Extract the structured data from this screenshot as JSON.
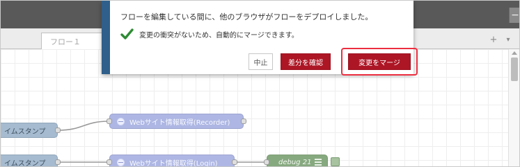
{
  "header": {
    "collapse_label": "−"
  },
  "tabs": [
    {
      "label": "フロー１"
    }
  ],
  "tabbar": {
    "add_label": "+",
    "menu_label": "▾"
  },
  "nodes": {
    "inject_1_label": "イムスタンプ",
    "inject_2_label": "イムスタンプ",
    "http_1_label": "Webサイト情報取得(Recorder)",
    "http_2_label": "Webサイト情報取得(Login)",
    "debug_label": "debug 21"
  },
  "dialog": {
    "message": "フローを編集している間に、他のブラウザがフローをデプロイしました。",
    "detail": "変更の衝突がないため、自動的にマージできます。",
    "cancel_label": "中止",
    "diff_label": "差分を確認",
    "merge_label": "変更をマージ"
  },
  "colors": {
    "dialog_accent": "#2f5f8a",
    "primary_button": "#ad1625",
    "highlight_outline": "#ec2e3f",
    "success_check": "#2e8b34",
    "inject_node": "#a6bbcf",
    "http_node": "#aeb7e3",
    "debug_node": "#87a980"
  },
  "icons": {
    "success": "check-icon",
    "http_node": "globe-icon",
    "debug_node": "list-icon",
    "tab_add": "plus-icon",
    "tab_menu": "chevron-down-icon",
    "scroll_up": "scroll-up-arrow-icon"
  }
}
